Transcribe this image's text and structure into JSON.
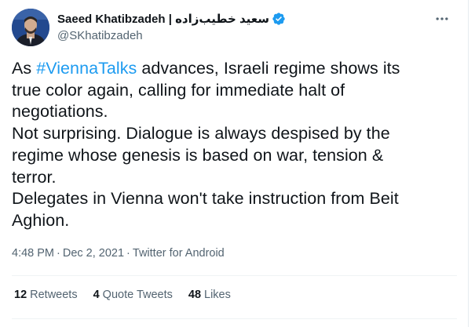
{
  "author": {
    "display_name": "Saeed Khatibzadeh | سعید خطیب‌زاده",
    "handle": "@SKhatibzadeh",
    "verified": true,
    "verified_color": "#1d9bf0"
  },
  "tweet": {
    "lines": [
      {
        "before": "As ",
        "hashtag": "#ViennaTalks",
        "after": " advances, Israeli regime shows its"
      },
      {
        "text": "true color again, calling for immediate halt of"
      },
      {
        "text": "negotiations."
      },
      {
        "text": "Not surprising. Dialogue is always despised by the"
      },
      {
        "text": "regime whose genesis is based on war, tension &"
      },
      {
        "text": "terror."
      },
      {
        "text": "Delegates in Vienna won't take instruction from Beit"
      },
      {
        "text": "Aghion."
      }
    ],
    "hashtag_color": "#1d9bf0"
  },
  "meta": {
    "time": "4:48 PM",
    "separator": "·",
    "date": "Dec 2, 2021",
    "source": "Twitter for Android"
  },
  "stats": {
    "retweets_count": "12",
    "retweets_label": "Retweets",
    "quotes_count": "4",
    "quotes_label": "Quote Tweets",
    "likes_count": "48",
    "likes_label": "Likes"
  },
  "icons": {
    "more": "more-horizontal-icon",
    "verified": "verified-badge-icon",
    "avatar": "avatar"
  }
}
